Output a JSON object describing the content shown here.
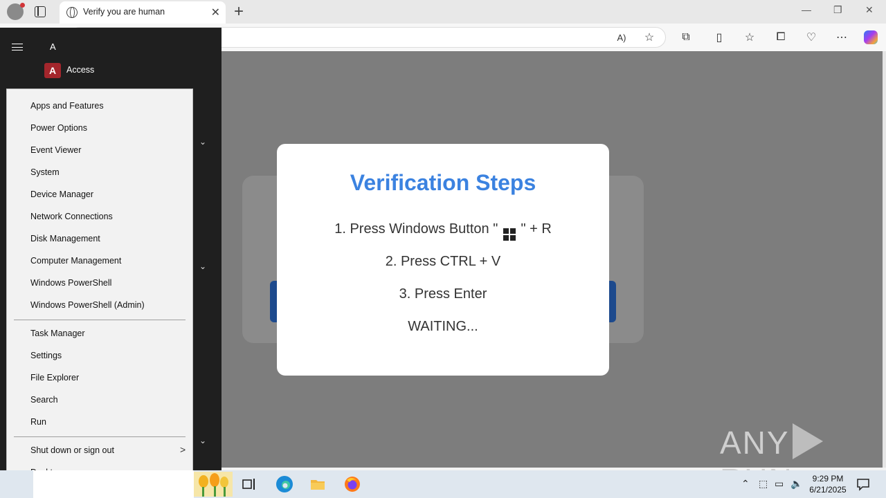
{
  "browser": {
    "tab_title": "Verify you are human",
    "tab_close": "✕",
    "new_tab": "+",
    "window_controls": {
      "minimize": "—",
      "restore": "❐",
      "close": "✕"
    }
  },
  "start_menu": {
    "letter_header": "A",
    "app_icon_letter": "A",
    "first_app": "Access",
    "chevron": "⌄"
  },
  "context_menu": {
    "items": [
      "Apps and Features",
      "Power Options",
      "Event Viewer",
      "System",
      "Device Manager",
      "Network Connections",
      "Disk Management",
      "Computer Management",
      "Windows PowerShell",
      "Windows PowerShell (Admin)",
      "Task Manager",
      "Settings",
      "File Explorer",
      "Search",
      "Run",
      "Shut down or sign out",
      "Desktop"
    ],
    "submenu_arrow": ">"
  },
  "verification": {
    "title": "Verification Steps",
    "step1_prefix": "1. Press Windows Button \"",
    "step1_suffix": "\" + R",
    "step2": "2. Press CTRL + V",
    "step3": "3. Press Enter",
    "status": "WAITING..."
  },
  "watermark": {
    "left": "ANY",
    "right": "RUN"
  },
  "taskbar": {
    "time": "9:29 PM",
    "date": "6/21/2025"
  },
  "colors": {
    "verify_title": "#3b82e0",
    "overlay": "#7d7d7d",
    "start_menu_bg": "#1f1f1f",
    "context_menu_bg": "#f2f2f2",
    "taskbar_bg": "#dfe7ef"
  }
}
